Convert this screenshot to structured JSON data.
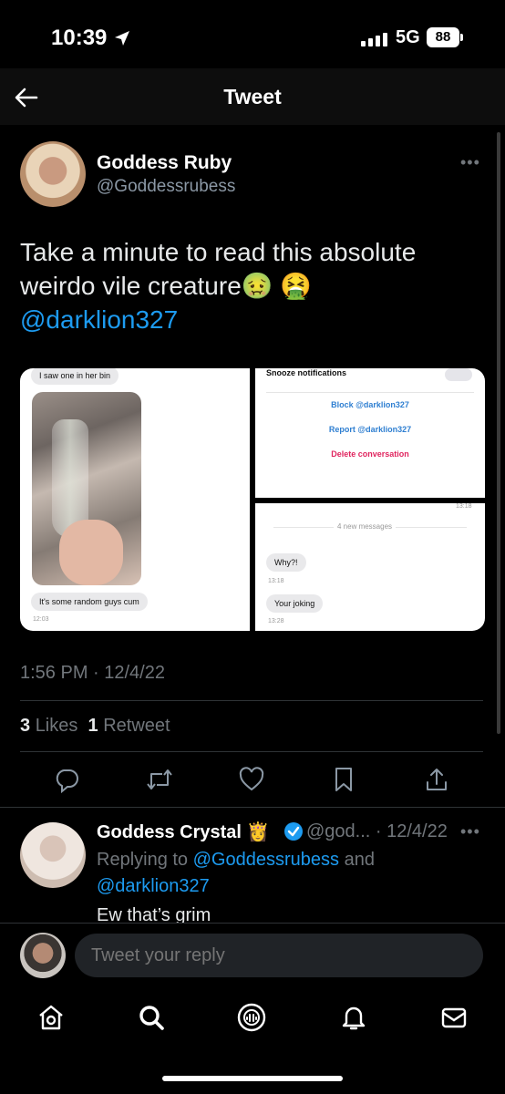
{
  "status": {
    "time": "10:39",
    "network": "5G",
    "battery": "88"
  },
  "header": {
    "title": "Tweet"
  },
  "tweet": {
    "author_name": "Goddess Ruby",
    "author_handle": "@Goddessrubess",
    "text": "Take a minute to read this absolute weirdo vile creature",
    "emojis": "🤢 🤮",
    "mention": "@darklion327",
    "timestamp": "1:56 PM · 12/4/22",
    "likes_count": "3",
    "likes_label": "Likes",
    "retweets_count": "1",
    "retweets_label": "Retweet"
  },
  "media": {
    "left": {
      "top_bubble": "I saw one in her bin",
      "bottom_bubble": "It's some random guys cum",
      "bottom_time": "12:03"
    },
    "right_top": {
      "snooze": "Snooze notifications",
      "block": "Block @darklion327",
      "report": "Report @darklion327",
      "delete": "Delete conversation"
    },
    "right_bottom": {
      "top_time": "13:18",
      "new_messages": "4 new messages",
      "msg1": "Why?!",
      "msg1_time": "13:18",
      "msg2": "Your joking",
      "msg2_time": "13:28"
    }
  },
  "reply": {
    "author_name": "Goddess Crystal",
    "badge_emoji": "👸",
    "meta": "@god... · 12/4/22",
    "replying_prefix": "Replying to",
    "replying_to_1": "@Goddessrubess",
    "replying_and": "and",
    "replying_to_2": "@darklion327",
    "text": "Ew that’s grim"
  },
  "composer": {
    "placeholder": "Tweet your reply"
  },
  "colors": {
    "accent": "#1d9bf0",
    "verified": "#1d9bf0",
    "delete_red": "#e0245e"
  },
  "icons": {
    "actions": [
      "reply-icon",
      "retweet-icon",
      "like-icon",
      "bookmark-icon",
      "share-icon"
    ],
    "nav": [
      "home-icon",
      "search-icon",
      "spaces-icon",
      "notifications-icon",
      "messages-icon"
    ]
  }
}
